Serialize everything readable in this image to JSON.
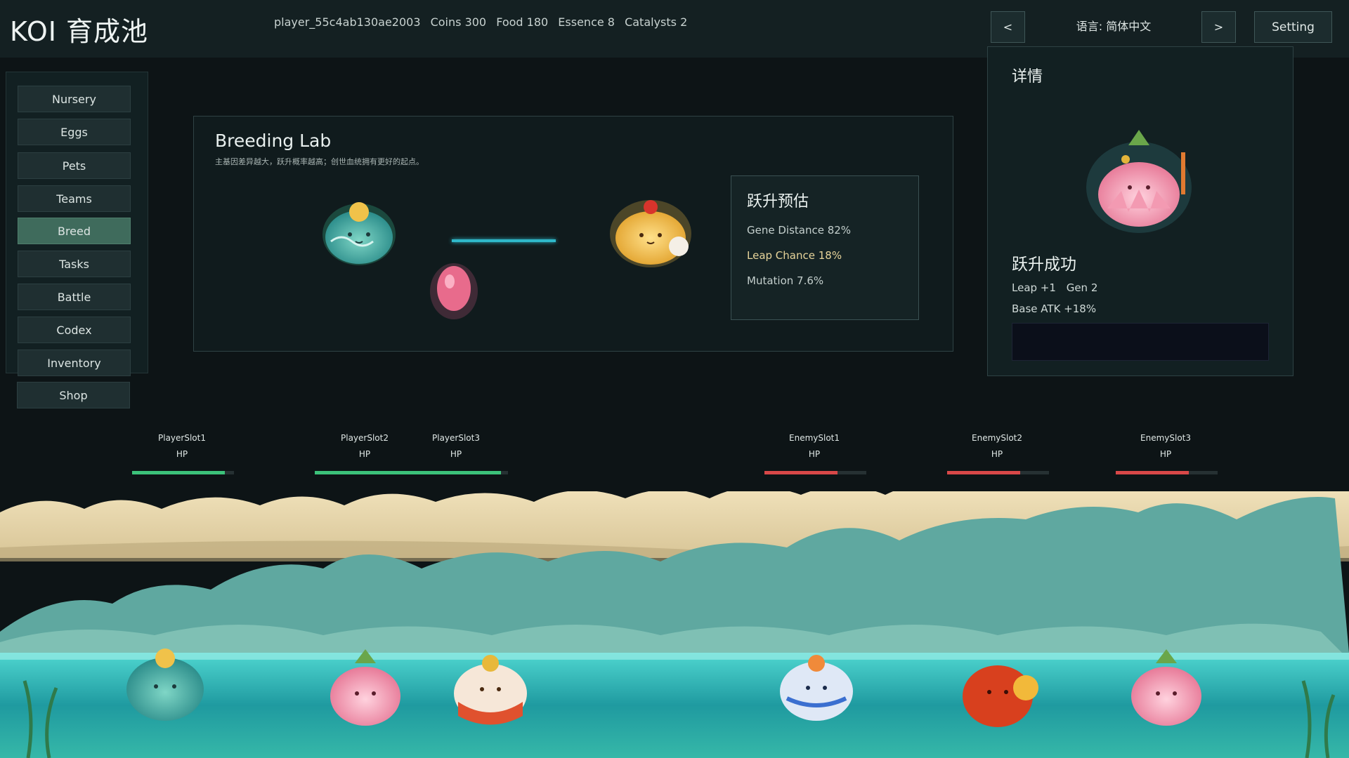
{
  "app": {
    "title": "KOI 育成池"
  },
  "status": {
    "player": "player_55c4ab130ae2003",
    "coins": "Coins 300",
    "food": "Food 180",
    "essence": "Essence 8",
    "catalysts": "Catalysts 2"
  },
  "header": {
    "prev_label": "<",
    "next_label": ">",
    "language": "语言: 简体中文",
    "setting_label": "Setting"
  },
  "sidebar": {
    "items": [
      {
        "label": "Nursery",
        "active": false
      },
      {
        "label": "Eggs",
        "active": false
      },
      {
        "label": "Pets",
        "active": false
      },
      {
        "label": "Teams",
        "active": false
      },
      {
        "label": "Breed",
        "active": true
      },
      {
        "label": "Tasks",
        "active": false
      },
      {
        "label": "Battle",
        "active": false
      },
      {
        "label": "Codex",
        "active": false
      },
      {
        "label": "Inventory",
        "active": false
      },
      {
        "label": "Shop",
        "active": false
      }
    ]
  },
  "breeding_lab": {
    "title": "Breeding Lab",
    "subtitle": "主基因差异越大，跃升概率越高；创世血统拥有更好的起点。",
    "estimate": {
      "title": "跃升预估",
      "gene_distance": "Gene Distance 82%",
      "leap_chance": "Leap Chance 18%",
      "mutation": "Mutation 7.6%"
    }
  },
  "details": {
    "title": "详情",
    "result": "跃升成功",
    "leap": "Leap +1",
    "gen": "Gen 2",
    "base_atk": "Base ATK +18%"
  },
  "slots": [
    {
      "name": "PlayerSlot1",
      "hp_label": "HP",
      "hp": 0.91,
      "side": "player"
    },
    {
      "name": "PlayerSlot2",
      "hp_label": "HP",
      "hp": 1.0,
      "side": "player"
    },
    {
      "name": "PlayerSlot3",
      "hp_label": "HP",
      "hp": 0.93,
      "side": "player"
    },
    {
      "name": "EnemySlot1",
      "hp_label": "HP",
      "hp": 0.72,
      "side": "enemy"
    },
    {
      "name": "EnemySlot2",
      "hp_label": "HP",
      "hp": 0.72,
      "side": "enemy"
    },
    {
      "name": "EnemySlot3",
      "hp_label": "HP",
      "hp": 0.72,
      "side": "enemy"
    }
  ],
  "colors": {
    "player_hp": "#3cc27a",
    "enemy_hp": "#d84848",
    "accent_line": "#2fb8c9",
    "leap_highlight": "#e7d49a"
  }
}
